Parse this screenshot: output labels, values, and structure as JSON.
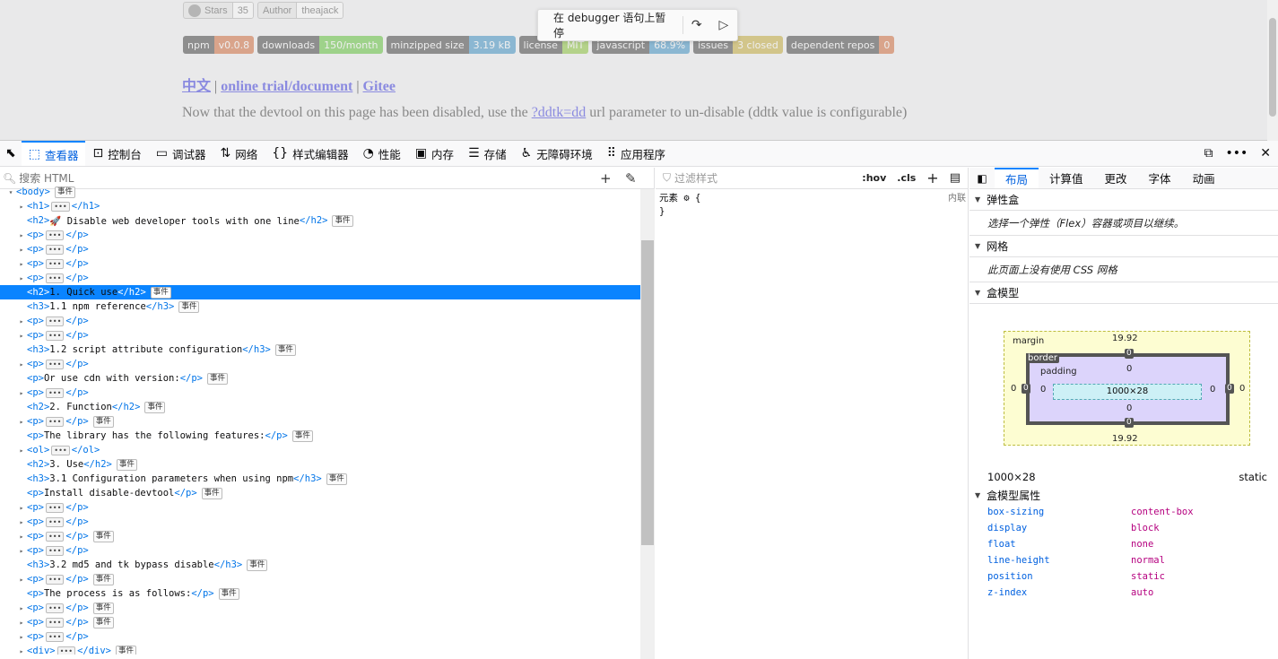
{
  "site": {
    "stars_label": "Stars",
    "stars_count": "35",
    "author_label": "Author",
    "author_value": "theajack",
    "badges": [
      {
        "label": "npm",
        "value": "v0.0.8",
        "color": "#d9a48b"
      },
      {
        "label": "downloads",
        "value": "150/month",
        "color": "#9ed28a"
      },
      {
        "label": "minzipped size",
        "value": "3.19 kB",
        "color": "#8bb7d2"
      },
      {
        "label": "license",
        "value": "MIT",
        "color": "#b4d28a"
      },
      {
        "label": "javascript",
        "value": "68.9%",
        "color": "#8bb7d2"
      },
      {
        "label": "issues",
        "value": "3 closed",
        "color": "#d2c58a"
      },
      {
        "label": "dependent repos",
        "value": "0",
        "color": "#d9a48b"
      }
    ],
    "link_zh": "中文",
    "link_trial": "online trial/document",
    "link_gitee": "Gitee",
    "separator": "|",
    "note_before": "Now that the devtool on this page has been disabled, use the",
    "note_link": "?ddtk=dd",
    "note_after": "url parameter to un-disable (ddtk value is configurable)"
  },
  "debugger": {
    "paused_text": "在 debugger 语句上暂停"
  },
  "toolbar": {
    "tabs": [
      {
        "label": "查看器",
        "icon": "inspector-icon",
        "glyph": "⬚",
        "selected": true
      },
      {
        "label": "控制台",
        "icon": "console-icon",
        "glyph": "⊡",
        "selected": false
      },
      {
        "label": "调试器",
        "icon": "debugger-icon",
        "glyph": "▭",
        "selected": false
      },
      {
        "label": "网络",
        "icon": "network-icon",
        "glyph": "⇅",
        "selected": false
      },
      {
        "label": "样式编辑器",
        "icon": "style-editor-icon",
        "glyph": "{}",
        "selected": false
      },
      {
        "label": "性能",
        "icon": "performance-icon",
        "glyph": "◔",
        "selected": false
      },
      {
        "label": "内存",
        "icon": "memory-icon",
        "glyph": "▣",
        "selected": false
      },
      {
        "label": "存储",
        "icon": "storage-icon",
        "glyph": "☰",
        "selected": false
      },
      {
        "label": "无障碍环境",
        "icon": "accessibility-icon",
        "glyph": "♿",
        "selected": false
      },
      {
        "label": "应用程序",
        "icon": "application-icon",
        "glyph": "⠿",
        "selected": false
      }
    ]
  },
  "inspector": {
    "search_placeholder": "搜索 HTML",
    "event_badge": "事件",
    "tree": [
      {
        "indent": 1,
        "twisty": "▾",
        "html": "<body>",
        "event": true,
        "clip": true
      },
      {
        "indent": 2,
        "twisty": "▸",
        "open": "<h1>",
        "collapsed": true,
        "close": "</h1>",
        "event": false
      },
      {
        "indent": 2,
        "twisty": "",
        "open": "<h2>",
        "text": "🚀 Disable web developer tools with one line",
        "close": "</h2>",
        "event": true
      },
      {
        "indent": 2,
        "twisty": "▸",
        "open": "<p>",
        "collapsed": true,
        "close": "</p>",
        "event": false
      },
      {
        "indent": 2,
        "twisty": "▸",
        "open": "<p>",
        "collapsed": true,
        "close": "</p>",
        "event": false
      },
      {
        "indent": 2,
        "twisty": "▸",
        "open": "<p>",
        "collapsed": true,
        "close": "</p>",
        "event": false
      },
      {
        "indent": 2,
        "twisty": "▸",
        "open": "<p>",
        "collapsed": true,
        "close": "</p>",
        "event": false
      },
      {
        "indent": 2,
        "twisty": "",
        "open": "<h2>",
        "text": "1. Quick use",
        "close": "</h2>",
        "event": true,
        "selected": true
      },
      {
        "indent": 2,
        "twisty": "",
        "open": "<h3>",
        "text": "1.1 npm reference",
        "close": "</h3>",
        "event": true
      },
      {
        "indent": 2,
        "twisty": "▸",
        "open": "<p>",
        "collapsed": true,
        "close": "</p>",
        "event": false
      },
      {
        "indent": 2,
        "twisty": "▸",
        "open": "<p>",
        "collapsed": true,
        "close": "</p>",
        "event": false
      },
      {
        "indent": 2,
        "twisty": "",
        "open": "<h3>",
        "text": "1.2 script attribute configuration",
        "close": "</h3>",
        "event": true
      },
      {
        "indent": 2,
        "twisty": "▸",
        "open": "<p>",
        "collapsed": true,
        "close": "</p>",
        "event": false
      },
      {
        "indent": 2,
        "twisty": "",
        "open": "<p>",
        "text": "Or use cdn with version:",
        "close": "</p>",
        "event": true
      },
      {
        "indent": 2,
        "twisty": "▸",
        "open": "<p>",
        "collapsed": true,
        "close": "</p>",
        "event": false
      },
      {
        "indent": 2,
        "twisty": "",
        "open": "<h2>",
        "text": "2. Function",
        "close": "</h2>",
        "event": true
      },
      {
        "indent": 2,
        "twisty": "▸",
        "open": "<p>",
        "collapsed": true,
        "close": "</p>",
        "event": true
      },
      {
        "indent": 2,
        "twisty": "",
        "open": "<p>",
        "text": "The library has the following features:",
        "close": "</p>",
        "event": true
      },
      {
        "indent": 2,
        "twisty": "▸",
        "open": "<ol>",
        "collapsed": true,
        "close": "</ol>",
        "event": false
      },
      {
        "indent": 2,
        "twisty": "",
        "open": "<h2>",
        "text": "3. Use",
        "close": "</h2>",
        "event": true
      },
      {
        "indent": 2,
        "twisty": "",
        "open": "<h3>",
        "text": "3.1 Configuration parameters when using npm",
        "close": "</h3>",
        "event": true
      },
      {
        "indent": 2,
        "twisty": "",
        "open": "<p>",
        "text": "Install disable-devtool",
        "close": "</p>",
        "event": true
      },
      {
        "indent": 2,
        "twisty": "▸",
        "open": "<p>",
        "collapsed": true,
        "close": "</p>",
        "event": false
      },
      {
        "indent": 2,
        "twisty": "▸",
        "open": "<p>",
        "collapsed": true,
        "close": "</p>",
        "event": false
      },
      {
        "indent": 2,
        "twisty": "▸",
        "open": "<p>",
        "collapsed": true,
        "close": "</p>",
        "event": true
      },
      {
        "indent": 2,
        "twisty": "▸",
        "open": "<p>",
        "collapsed": true,
        "close": "</p>",
        "event": false
      },
      {
        "indent": 2,
        "twisty": "",
        "open": "<h3>",
        "text": "3.2 md5 and tk bypass disable",
        "close": "</h3>",
        "event": true
      },
      {
        "indent": 2,
        "twisty": "▸",
        "open": "<p>",
        "collapsed": true,
        "close": "</p>",
        "event": true
      },
      {
        "indent": 2,
        "twisty": "",
        "open": "<p>",
        "text": "The process is as follows:",
        "close": "</p>",
        "event": true
      },
      {
        "indent": 2,
        "twisty": "▸",
        "open": "<p>",
        "collapsed": true,
        "close": "</p>",
        "event": true
      },
      {
        "indent": 2,
        "twisty": "▸",
        "open": "<p>",
        "collapsed": true,
        "close": "</p>",
        "event": true
      },
      {
        "indent": 2,
        "twisty": "▸",
        "open": "<p>",
        "collapsed": true,
        "close": "</p>",
        "event": false
      },
      {
        "indent": 2,
        "twisty": "▸",
        "open": "<div>",
        "collapsed": true,
        "close": "</div>",
        "event": true
      }
    ]
  },
  "rules": {
    "filter_placeholder": "过滤样式",
    "hov": ":hov",
    "cls": ".cls",
    "element_label": "元素",
    "open_brace": "{",
    "close_brace": "}",
    "inline_label": "内联"
  },
  "layout": {
    "tabs": [
      {
        "label": "布局",
        "selected": true
      },
      {
        "label": "计算值",
        "selected": false
      },
      {
        "label": "更改",
        "selected": false
      },
      {
        "label": "字体",
        "selected": false
      },
      {
        "label": "动画",
        "selected": false
      }
    ],
    "flex_title": "弹性盒",
    "flex_body": "选择一个弹性（Flex）容器或项目以继续。",
    "grid_title": "网格",
    "grid_body": "此页面上没有使用 CSS 网格",
    "boxmodel_title": "盒模型",
    "box": {
      "margin_label": "margin",
      "border_label": "border",
      "padding_label": "padding",
      "margin_top": "19.92",
      "margin_bottom": "19.92",
      "margin_left": "0",
      "margin_right": "0",
      "border_top": "0",
      "border_bottom": "0",
      "border_left": "0",
      "border_right": "0",
      "padding_top": "0",
      "padding_bottom": "0",
      "padding_left": "0",
      "padding_right": "0",
      "content": "1000×28"
    },
    "dimensions": "1000×28",
    "position": "static",
    "props_title": "盒模型属性",
    "props": [
      {
        "k": "box-sizing",
        "v": "content-box"
      },
      {
        "k": "display",
        "v": "block"
      },
      {
        "k": "float",
        "v": "none"
      },
      {
        "k": "line-height",
        "v": "normal"
      },
      {
        "k": "position",
        "v": "static"
      },
      {
        "k": "z-index",
        "v": "auto"
      }
    ]
  }
}
